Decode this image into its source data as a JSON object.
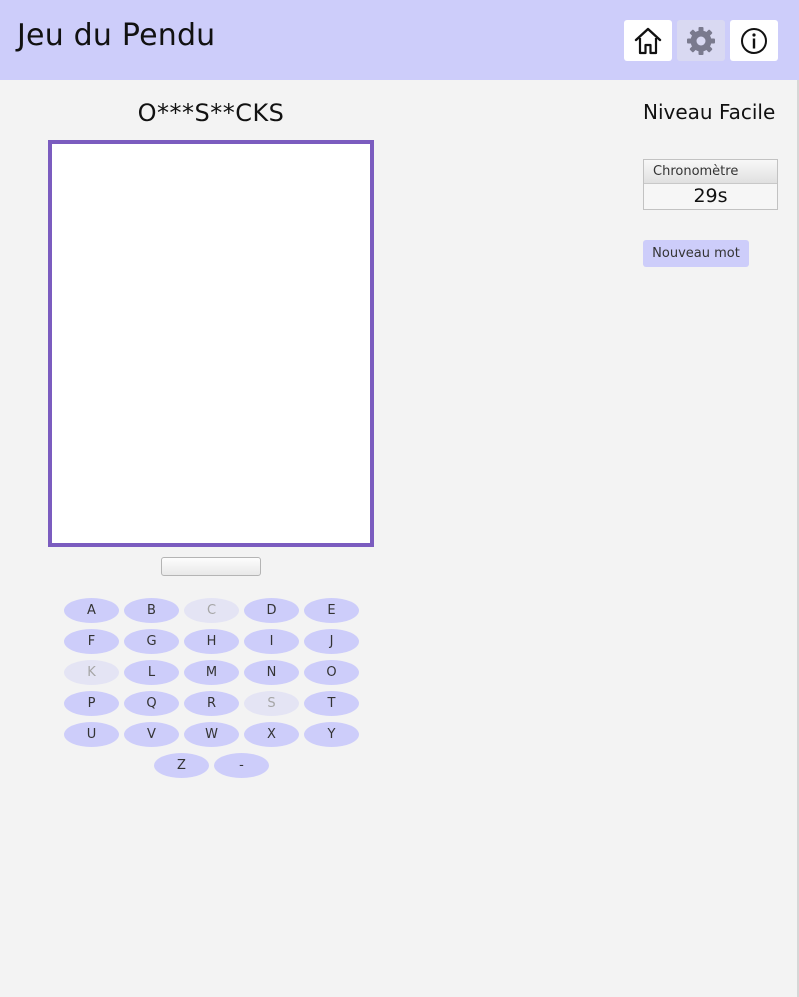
{
  "header": {
    "title": "Jeu du Pendu",
    "buttons": [
      {
        "icon": "home-icon"
      },
      {
        "icon": "gear-icon"
      },
      {
        "icon": "info-icon"
      }
    ],
    "background": "#cdcdfa"
  },
  "game": {
    "masked_word": "O***S**CKS",
    "progress": 0,
    "keyboard": [
      {
        "letter": "A",
        "used": false
      },
      {
        "letter": "B",
        "used": false
      },
      {
        "letter": "C",
        "used": true
      },
      {
        "letter": "D",
        "used": false
      },
      {
        "letter": "E",
        "used": false
      },
      {
        "letter": "F",
        "used": false
      },
      {
        "letter": "G",
        "used": false
      },
      {
        "letter": "H",
        "used": false
      },
      {
        "letter": "I",
        "used": false
      },
      {
        "letter": "J",
        "used": false
      },
      {
        "letter": "K",
        "used": true
      },
      {
        "letter": "L",
        "used": false
      },
      {
        "letter": "M",
        "used": false
      },
      {
        "letter": "N",
        "used": false
      },
      {
        "letter": "O",
        "used": false
      },
      {
        "letter": "P",
        "used": false
      },
      {
        "letter": "Q",
        "used": false
      },
      {
        "letter": "R",
        "used": false
      },
      {
        "letter": "S",
        "used": true
      },
      {
        "letter": "T",
        "used": false
      },
      {
        "letter": "U",
        "used": false
      },
      {
        "letter": "V",
        "used": false
      },
      {
        "letter": "W",
        "used": false
      },
      {
        "letter": "X",
        "used": false
      },
      {
        "letter": "Y",
        "used": false
      },
      {
        "letter": "Z",
        "used": false
      },
      {
        "letter": "-",
        "used": false
      }
    ]
  },
  "sidebar": {
    "level": "Niveau Facile",
    "timer_label": "Chronomètre",
    "timer_value": "29s",
    "new_word_label": "Nouveau mot"
  },
  "colors": {
    "accent": "#cdcdfa",
    "canvas_border": "#7b5cbf",
    "used_key": "#e4e4f4"
  }
}
